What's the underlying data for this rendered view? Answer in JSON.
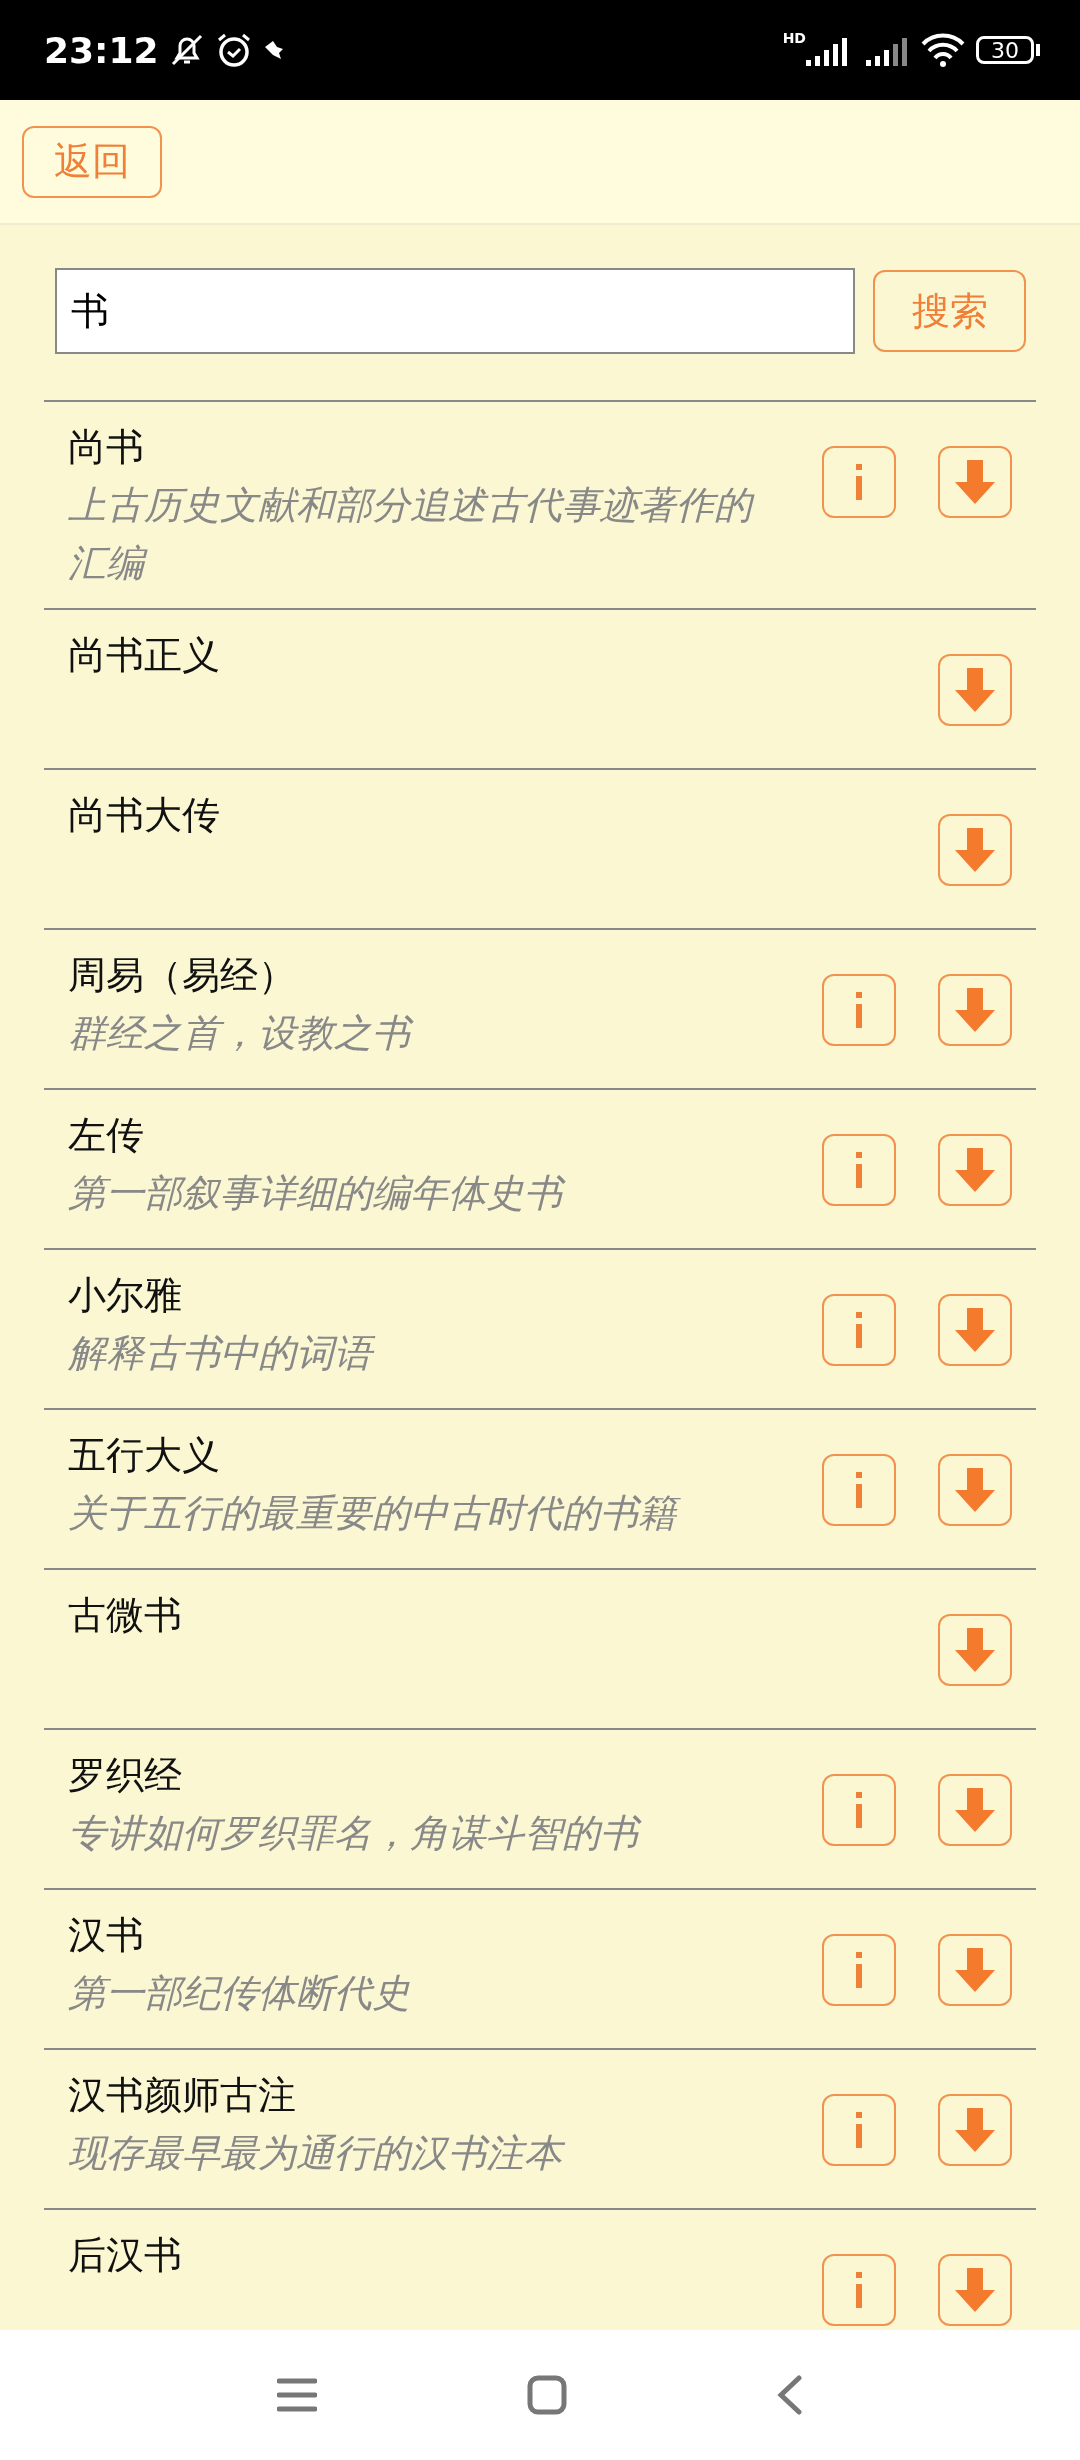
{
  "status_bar": {
    "time": "23:12",
    "battery": "30",
    "network_type": "HD"
  },
  "header": {
    "back_button": "返回"
  },
  "search": {
    "value": "书",
    "button": "搜索"
  },
  "books": [
    {
      "title": "尚书",
      "description": "上古历史文献和部分追述古代事迹著作的汇编",
      "has_info": true
    },
    {
      "title": "尚书正义",
      "has_info": false
    },
    {
      "title": "尚书大传",
      "has_info": false
    },
    {
      "title": "周易（易经）",
      "description": "群经之首，设教之书",
      "has_info": true
    },
    {
      "title": "左传",
      "description": "第一部叙事详细的编年体史书",
      "has_info": true
    },
    {
      "title": "小尔雅",
      "description": "解释古书中的词语",
      "has_info": true
    },
    {
      "title": "五行大义",
      "description": "关于五行的最重要的中古时代的书籍",
      "has_info": true
    },
    {
      "title": "古微书",
      "has_info": false
    },
    {
      "title": "罗织经",
      "description": "专讲如何罗织罪名，角谋斗智的书",
      "has_info": true
    },
    {
      "title": "汉书",
      "description": "第一部纪传体断代史",
      "has_info": true
    },
    {
      "title": "汉书颜师古注",
      "description": "现存最早最为通行的汉书注本",
      "has_info": true
    },
    {
      "title": "后汉书",
      "has_info": true
    }
  ]
}
